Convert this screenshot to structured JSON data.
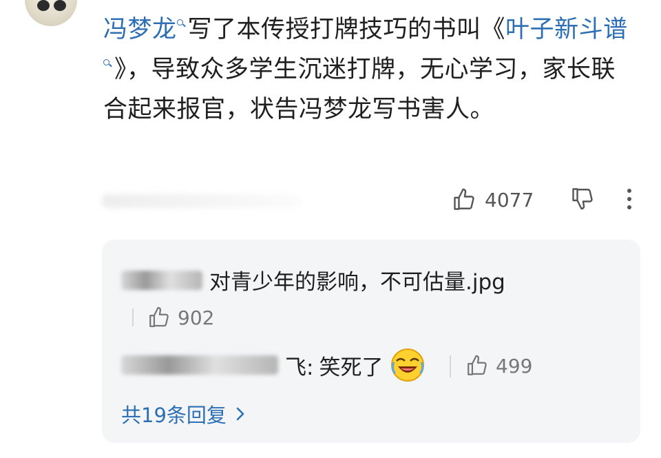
{
  "comment": {
    "link_name": "冯梦龙",
    "text_part1": "写了本传授打牌技巧的书叫",
    "book_open": "《",
    "book_title_line1": "叶子",
    "book_title_line2": "新斗谱",
    "text_part2": "》，导致众多学生沉迷打牌，无心学习，家长联合起来报官，状告冯梦龙写书害人。",
    "like_count": "4077"
  },
  "replies": [
    {
      "text": "对青少年的影响，不可估量.jpg",
      "like_count": "902"
    },
    {
      "suffix": "飞:",
      "text": "笑死了",
      "emoji": "laughing-emoji",
      "like_count": "499"
    }
  ],
  "more_replies_label": "共19条回复",
  "colors": {
    "link": "#2c6fb5",
    "reply_bg": "#f4f5f7"
  }
}
